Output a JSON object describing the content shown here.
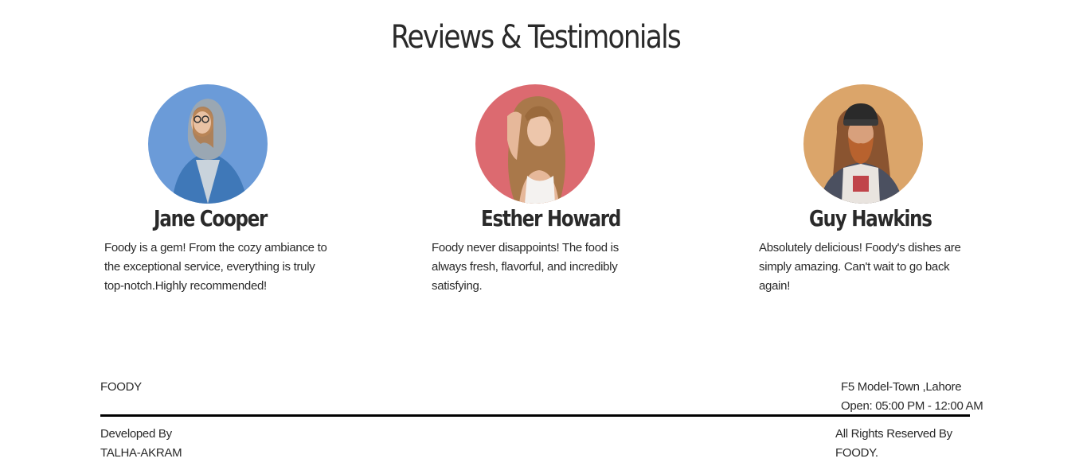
{
  "section": {
    "title": "Reviews & Testimonials"
  },
  "reviews": [
    {
      "name": "Jane Cooper",
      "text": "Foody is a gem! From the cozy ambiance to the exceptional service, everything is truly top-notch.Highly recommended!",
      "avatar_bg": "#6b9bd8"
    },
    {
      "name": "Esther Howard",
      "text": "Foody never disappoints! The food is always fresh, flavorful, and incredibly satisfying.",
      "avatar_bg": "#dc6a70"
    },
    {
      "name": "Guy Hawkins",
      "text": "Absolutely delicious! Foody's dishes are simply amazing. Can't wait to go back again!",
      "avatar_bg": "#dba56a"
    }
  ],
  "footer": {
    "brand": "FOODY",
    "address": "F5 Model-Town ,Lahore",
    "hours": "Open: 05:00 PM - 12:00 AM",
    "developer": "Developed By TALHA-AKRAM",
    "rights": "All Rights Reserved By FOODY."
  }
}
